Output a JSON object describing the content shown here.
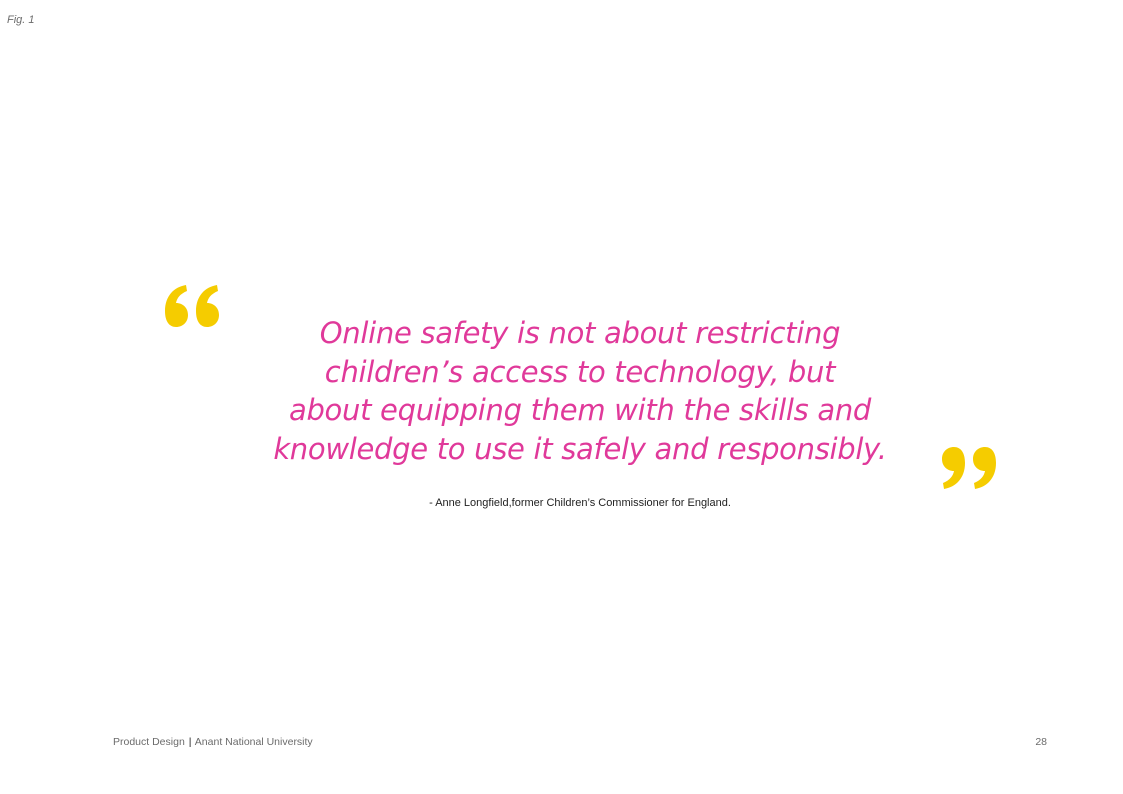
{
  "figure_label": "Fig. 1",
  "quote": {
    "lines": [
      "Online safety is not about restricting",
      "children’s access to technology, but",
      "about equipping them with the skills and",
      "knowledge to use it safely and responsibly."
    ],
    "color": "#e0399a",
    "attribution": "- Anne Longfield,former Children’s Commissioner for England."
  },
  "quote_marks": {
    "color": "#f5cc00",
    "open_icon": "open-quote-icon",
    "close_icon": "close-quote-icon"
  },
  "footer": {
    "course": "Product Design",
    "separator": "|",
    "institution": "Anant National University",
    "page_number": "28"
  }
}
